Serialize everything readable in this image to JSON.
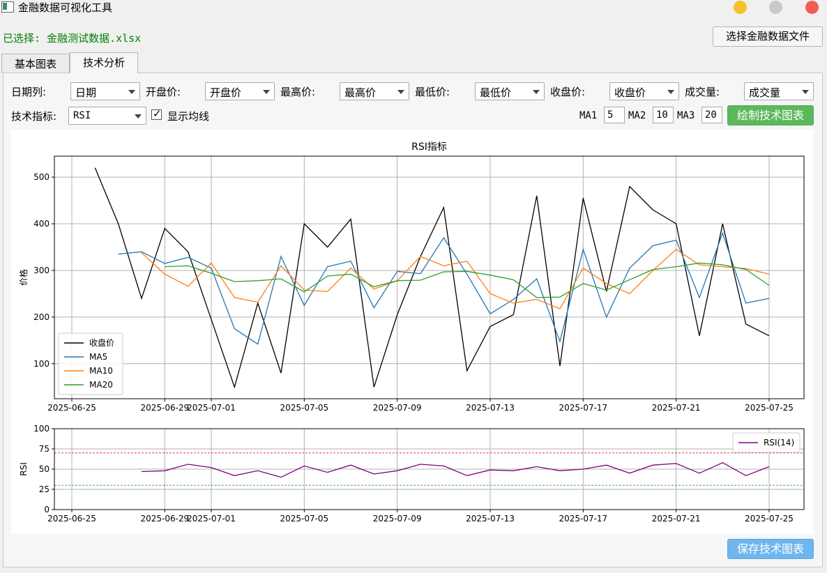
{
  "window": {
    "title": "金融数据可视化工具",
    "controls": {
      "minimize_color": "#f5c02a",
      "maximize_color": "#c9c9c9",
      "close_color": "#f25c55"
    }
  },
  "selected_file": "已选择: 金融测试数据.xlsx",
  "select_file_button": "选择金融数据文件",
  "tabs": [
    {
      "label": "基本图表",
      "active": false
    },
    {
      "label": "技术分析",
      "active": true
    }
  ],
  "column_mapping": [
    {
      "label": "日期列:",
      "value": "日期"
    },
    {
      "label": "开盘价:",
      "value": "开盘价"
    },
    {
      "label": "最高价:",
      "value": "最高价"
    },
    {
      "label": "最低价:",
      "value": "最低价"
    },
    {
      "label": "收盘价:",
      "value": "收盘价"
    },
    {
      "label": "成交量:",
      "value": "成交量"
    }
  ],
  "indicator": {
    "label": "技术指标:",
    "value": "RSI"
  },
  "show_ma": {
    "label": "显示均线",
    "checked": true
  },
  "ma_inputs": [
    {
      "label": "MA1",
      "value": "5"
    },
    {
      "label": "MA2",
      "value": "10"
    },
    {
      "label": "MA3",
      "value": "20"
    }
  ],
  "draw_button": "绘制技术图表",
  "save_button": "保存技术图表",
  "chart_data": [
    {
      "type": "line",
      "title": "RSI指标",
      "xlabel": "",
      "ylabel": "价格",
      "x": [
        "2025-06-26",
        "2025-06-27",
        "2025-06-28",
        "2025-06-29",
        "2025-06-30",
        "2025-07-01",
        "2025-07-02",
        "2025-07-03",
        "2025-07-04",
        "2025-07-05",
        "2025-07-06",
        "2025-07-07",
        "2025-07-08",
        "2025-07-09",
        "2025-07-10",
        "2025-07-11",
        "2025-07-12",
        "2025-07-13",
        "2025-07-14",
        "2025-07-15",
        "2025-07-16",
        "2025-07-17",
        "2025-07-18",
        "2025-07-19",
        "2025-07-20",
        "2025-07-21",
        "2025-07-22",
        "2025-07-23",
        "2025-07-24",
        "2025-07-25"
      ],
      "xticks": [
        "2025-06-25",
        "2025-06-29",
        "2025-07-01",
        "2025-07-05",
        "2025-07-09",
        "2025-07-13",
        "2025-07-17",
        "2025-07-21",
        "2025-07-25"
      ],
      "xlim": [
        "2025-06-24 06:00",
        "2025-07-26 12:00"
      ],
      "ylim": [
        25,
        545
      ],
      "yticks": [
        100,
        200,
        300,
        400,
        500
      ],
      "grid": true,
      "legend_position": "lower-left",
      "series": [
        {
          "name": "收盘价",
          "color": "#000000",
          "values": [
            520,
            400,
            240,
            390,
            340,
            195,
            50,
            230,
            80,
            400,
            350,
            410,
            50,
            205,
            330,
            435,
            85,
            180,
            205,
            460,
            95,
            455,
            255,
            480,
            430,
            400,
            160,
            400,
            185,
            160
          ]
        },
        {
          "name": "MA5",
          "color": "#1f77b4",
          "values": [
            null,
            335,
            340,
            315,
            328,
            305,
            175,
            142,
            330,
            225,
            308,
            320,
            220,
            298,
            293,
            370,
            292,
            207,
            238,
            282,
            148,
            345,
            200,
            305,
            353,
            365,
            242,
            380,
            230,
            240
          ]
        },
        {
          "name": "MA10",
          "color": "#ff7f0e",
          "values": [
            null,
            null,
            338,
            292,
            266,
            316,
            242,
            232,
            310,
            258,
            255,
            305,
            260,
            278,
            330,
            310,
            320,
            250,
            230,
            238,
            218,
            305,
            272,
            250,
            300,
            345,
            312,
            308,
            304,
            292
          ]
        },
        {
          "name": "MA20",
          "color": "#2ca02c",
          "values": [
            null,
            null,
            null,
            308,
            310,
            294,
            276,
            278,
            282,
            254,
            288,
            292,
            265,
            278,
            279,
            297,
            298,
            290,
            280,
            242,
            243,
            272,
            258,
            280,
            302,
            308,
            316,
            312,
            302,
            268
          ]
        }
      ]
    },
    {
      "type": "line",
      "title": "",
      "xlabel": "",
      "ylabel": "RSI",
      "x": [
        "2025-06-26",
        "2025-06-27",
        "2025-06-28",
        "2025-06-29",
        "2025-06-30",
        "2025-07-01",
        "2025-07-02",
        "2025-07-03",
        "2025-07-04",
        "2025-07-05",
        "2025-07-06",
        "2025-07-07",
        "2025-07-08",
        "2025-07-09",
        "2025-07-10",
        "2025-07-11",
        "2025-07-12",
        "2025-07-13",
        "2025-07-14",
        "2025-07-15",
        "2025-07-16",
        "2025-07-17",
        "2025-07-18",
        "2025-07-19",
        "2025-07-20",
        "2025-07-21",
        "2025-07-22",
        "2025-07-23",
        "2025-07-24",
        "2025-07-25"
      ],
      "xticks": [
        "2025-06-25",
        "2025-06-29",
        "2025-07-01",
        "2025-07-05",
        "2025-07-09",
        "2025-07-13",
        "2025-07-17",
        "2025-07-21",
        "2025-07-25"
      ],
      "ylim": [
        0,
        100
      ],
      "yticks": [
        0,
        25,
        50,
        75,
        100
      ],
      "grid": true,
      "legend_position": "upper-right",
      "overbought": 70,
      "oversold": 30,
      "overbought_color": "#d62728",
      "oversold_color": "#2ca02c",
      "series": [
        {
          "name": "RSI(14)",
          "color": "#800080",
          "values": [
            null,
            null,
            47,
            48,
            56,
            52,
            42,
            48,
            40,
            54,
            46,
            55,
            44,
            48,
            56,
            54,
            42,
            49,
            48,
            53,
            48,
            50,
            55,
            45,
            55,
            57,
            45,
            58,
            42,
            53
          ]
        }
      ]
    }
  ]
}
